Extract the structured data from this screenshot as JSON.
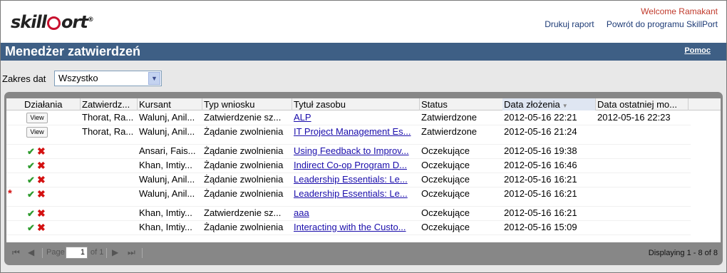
{
  "header": {
    "logo_text_a": "skill",
    "logo_text_b": "ort",
    "logo_tm": "®",
    "welcome": "Welcome Ramakant",
    "print_report": "Drukuj raport",
    "back_to_program": "Powrót do programu SkillPort"
  },
  "titlebar": {
    "title": "Menedżer zatwierdzeń",
    "help": "Pomoc"
  },
  "filter": {
    "label": "Zakres dat",
    "value": "Wszystko"
  },
  "grid": {
    "columns": [
      "Działania",
      "Zatwierdz...",
      "Kursant",
      "Typ wniosku",
      "Tytuł zasobu",
      "Status",
      "Data złożenia",
      "Data ostatniej mo..."
    ],
    "view_label": "View",
    "star": "*",
    "rows": [
      {
        "approver": "Thorat, Ra...",
        "learner": "Walunj, Anil...",
        "type": "Zatwierdzenie sz...",
        "title": "ALP",
        "status": "Zatwierdzone",
        "submitted": "2012-05-16 22:21",
        "modified": "2012-05-16 22:23"
      },
      {
        "approver": "Thorat, Ra...",
        "learner": "Walunj, Anil...",
        "type": "Żądanie zwolnienia",
        "title": "IT Project Management Es...",
        "status": "Zatwierdzone",
        "submitted": "2012-05-16 21:24",
        "modified": ""
      },
      {
        "approver": "",
        "learner": "Ansari, Fais...",
        "type": "Żądanie zwolnienia",
        "title": "Using Feedback to Improv...",
        "status": "Oczekujące",
        "submitted": "2012-05-16 19:38",
        "modified": ""
      },
      {
        "approver": "",
        "learner": "Khan, Imtiy...",
        "type": "Żądanie zwolnienia",
        "title": "Indirect Co-op Program D...",
        "status": "Oczekujące",
        "submitted": "2012-05-16 16:46",
        "modified": ""
      },
      {
        "approver": "",
        "learner": "Walunj, Anil...",
        "type": "Żądanie zwolnienia",
        "title": "Leadership Essentials: Le...",
        "status": "Oczekujące",
        "submitted": "2012-05-16 16:21",
        "modified": ""
      },
      {
        "approver": "",
        "learner": "Walunj, Anil...",
        "type": "Żądanie zwolnienia",
        "title": "Leadership Essentials: Le...",
        "status": "Oczekujące",
        "submitted": "2012-05-16 16:21",
        "modified": ""
      },
      {
        "approver": "",
        "learner": "Khan, Imtiy...",
        "type": "Zatwierdzenie sz...",
        "title": "aaa",
        "status": "Oczekujące",
        "submitted": "2012-05-16 16:21",
        "modified": ""
      },
      {
        "approver": "",
        "learner": "Khan, Imtiy...",
        "type": "Żądanie zwolnienia",
        "title": "Interacting with the Custo...",
        "status": "Oczekujące",
        "submitted": "2012-05-16 15:09",
        "modified": ""
      }
    ]
  },
  "pager": {
    "page_label": "Page",
    "page_value": "1",
    "of_label": "of 1",
    "displaying": "Displaying 1 - 8 of 8"
  }
}
